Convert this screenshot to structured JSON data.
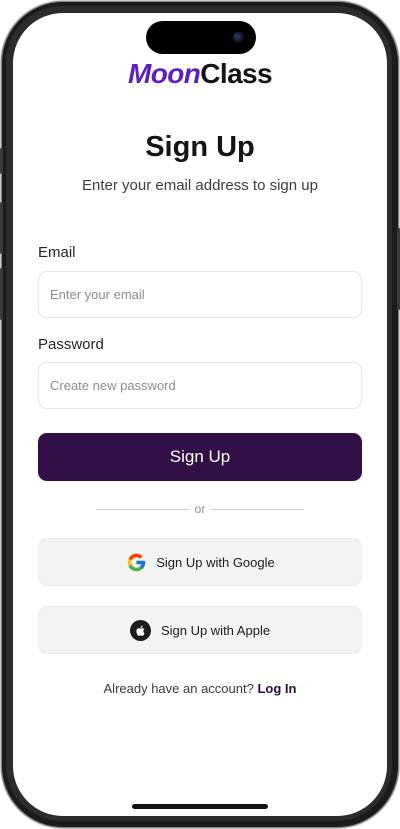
{
  "brand": {
    "part1": "Moon",
    "part2": "Class",
    "accent_color": "#5b1fc4"
  },
  "header": {
    "title": "Sign Up",
    "subtitle": "Enter your email address to sign up"
  },
  "form": {
    "email": {
      "label": "Email",
      "placeholder": "Enter your email",
      "value": ""
    },
    "password": {
      "label": "Password",
      "placeholder": "Create new password",
      "value": ""
    },
    "submit_label": "Sign Up",
    "submit_color": "#330f47"
  },
  "divider": {
    "text": "or"
  },
  "social": {
    "google": {
      "label": "Sign Up with Google",
      "icon": "google-icon"
    },
    "apple": {
      "label": "Sign Up with Apple",
      "icon": "apple-icon"
    }
  },
  "footer": {
    "prompt": "Already have an account?",
    "link": "Log In"
  }
}
